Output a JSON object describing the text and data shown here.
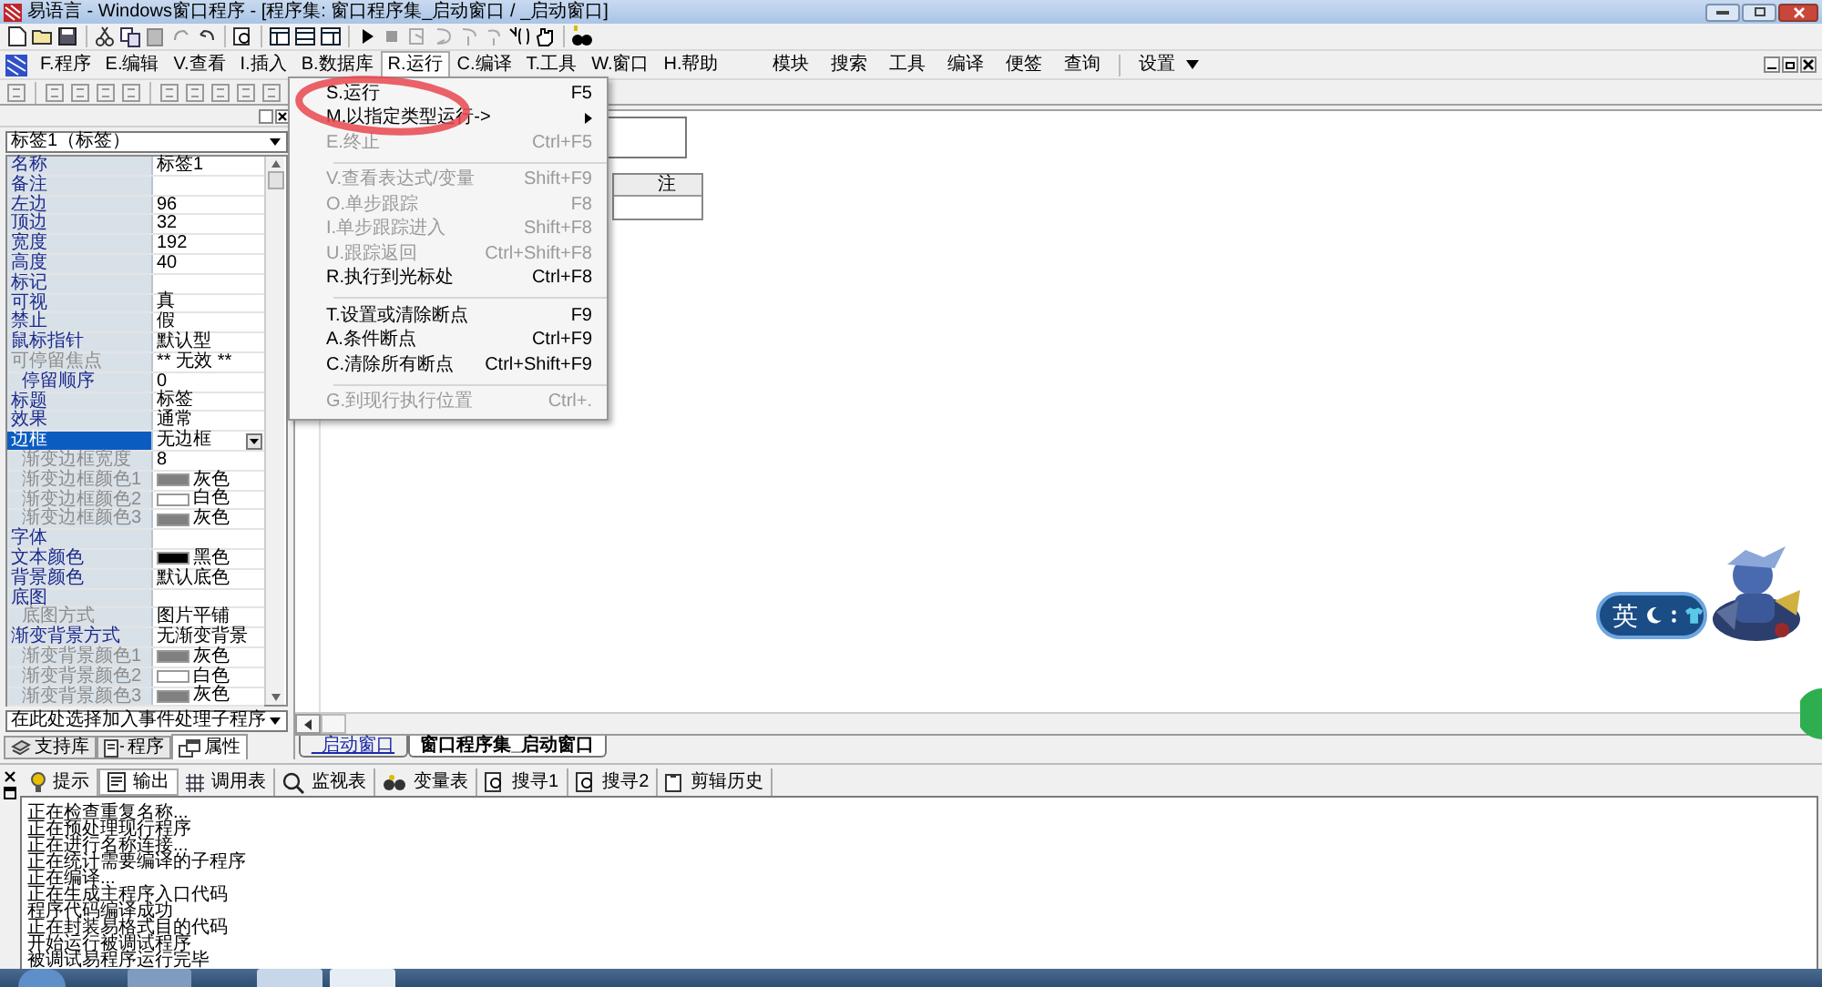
{
  "window": {
    "title": "易语言 - Windows窗口程序 - [程序集: 窗口程序集_启动窗口 / _启动窗口]"
  },
  "menu_bar": {
    "items": [
      {
        "label": "F.程序",
        "open": false
      },
      {
        "label": "E.编辑",
        "open": false
      },
      {
        "label": "V.查看",
        "open": false
      },
      {
        "label": "I.插入",
        "open": false
      },
      {
        "label": "B.数据库",
        "open": false
      },
      {
        "label": "R.运行",
        "open": true
      },
      {
        "label": "C.编译",
        "open": false
      },
      {
        "label": "T.工具",
        "open": false
      },
      {
        "label": "W.窗口",
        "open": false
      },
      {
        "label": "H.帮助",
        "open": false
      }
    ]
  },
  "quick_bar": {
    "items": [
      "模块",
      "搜索",
      "工具",
      "编译",
      "便签",
      "查询",
      "设置"
    ]
  },
  "run_menu": {
    "items": [
      {
        "kind": "item",
        "label": "S.运行",
        "shortcut": "F5",
        "disabled": false
      },
      {
        "kind": "submenu",
        "label": "M.以指定类型运行->",
        "disabled": false
      },
      {
        "kind": "item",
        "label": "E.终止",
        "shortcut": "Ctrl+F5",
        "disabled": true
      },
      {
        "kind": "separator"
      },
      {
        "kind": "item",
        "label": "V.查看表达式/变量",
        "shortcut": "Shift+F9",
        "disabled": true
      },
      {
        "kind": "item",
        "label": "O.单步跟踪",
        "shortcut": "F8",
        "disabled": true
      },
      {
        "kind": "item",
        "label": "I.单步跟踪进入",
        "shortcut": "Shift+F8",
        "disabled": true
      },
      {
        "kind": "item",
        "label": "U.跟踪返回",
        "shortcut": "Ctrl+Shift+F8",
        "disabled": true
      },
      {
        "kind": "item",
        "label": "R.执行到光标处",
        "shortcut": "Ctrl+F8",
        "disabled": false
      },
      {
        "kind": "separator"
      },
      {
        "kind": "item",
        "label": "T.设置或清除断点",
        "shortcut": "F9",
        "disabled": false
      },
      {
        "kind": "item",
        "label": "A.条件断点",
        "shortcut": "Ctrl+F9",
        "disabled": false
      },
      {
        "kind": "item",
        "label": "C.清除所有断点",
        "shortcut": "Ctrl+Shift+F9",
        "disabled": false
      },
      {
        "kind": "separator"
      },
      {
        "kind": "item",
        "label": "G.到现行执行位置",
        "shortcut": "Ctrl+.",
        "disabled": true
      }
    ]
  },
  "properties": {
    "object": "标签1（标签）",
    "rows": [
      {
        "name": "名称",
        "value": "标签1",
        "selected": false,
        "disabled": false
      },
      {
        "name": "备注",
        "selected": false,
        "disabled": false
      },
      {
        "name": "左边",
        "value": "96",
        "selected": false,
        "disabled": false
      },
      {
        "name": "顶边",
        "value": "32",
        "selected": false,
        "disabled": false
      },
      {
        "name": "宽度",
        "value": "192",
        "selected": false,
        "disabled": false
      },
      {
        "name": "高度",
        "value": "40",
        "selected": false,
        "disabled": false
      },
      {
        "name": "标记",
        "selected": false,
        "disabled": false
      },
      {
        "name": "可视",
        "value": "真",
        "selected": false,
        "disabled": false
      },
      {
        "name": "禁止",
        "value": "假",
        "selected": false,
        "disabled": false
      },
      {
        "name": "鼠标指针",
        "value": "默认型",
        "selected": false,
        "disabled": false
      },
      {
        "name": "可停留焦点",
        "value": "** 无效 **",
        "selected": false,
        "disabled": true,
        "children": [
          {
            "name": "停留顺序",
            "value": "0",
            "selected": false,
            "disabled": false
          }
        ]
      },
      {
        "name": "标题",
        "value": "标签",
        "selected": false,
        "disabled": false
      },
      {
        "name": "效果",
        "value": "通常",
        "selected": false,
        "disabled": false
      },
      {
        "name": "边框",
        "value": "无边框",
        "selected": true,
        "disabled": false,
        "children": [
          {
            "name": "渐变边框宽度",
            "value": "8",
            "selected": false,
            "disabled": true
          },
          {
            "name": "渐变边框颜色1",
            "value": "灰色",
            "color": "#808080",
            "selected": false,
            "disabled": true
          },
          {
            "name": "渐变边框颜色2",
            "value": "白色",
            "color": "#ffffff",
            "selected": false,
            "disabled": true
          },
          {
            "name": "渐变边框颜色3",
            "value": "灰色",
            "color": "#808080",
            "selected": false,
            "disabled": true
          }
        ]
      },
      {
        "name": "字体",
        "selected": false,
        "disabled": false
      },
      {
        "name": "文本颜色",
        "value": "黑色",
        "color": "#000000",
        "selected": false,
        "disabled": false
      },
      {
        "name": "背景颜色",
        "value": "默认底色",
        "selected": false,
        "disabled": false
      },
      {
        "name": "底图",
        "selected": false,
        "disabled": false,
        "children": [
          {
            "name": "底图方式",
            "value": "图片平铺",
            "selected": false,
            "disabled": true
          }
        ]
      },
      {
        "name": "渐变背景方式",
        "value": "无渐变背景",
        "selected": false,
        "disabled": false,
        "children": [
          {
            "name": "渐变背景颜色1",
            "value": "灰色",
            "color": "#808080",
            "selected": false,
            "disabled": true
          },
          {
            "name": "渐变背景颜色2",
            "value": "白色",
            "color": "#ffffff",
            "selected": false,
            "disabled": true
          },
          {
            "name": "渐变背景颜色3",
            "value": "灰色",
            "color": "#808080",
            "selected": false,
            "disabled": true
          }
        ]
      }
    ],
    "event_picker": "在此处选择加入事件处理子程序",
    "tabs": [
      {
        "label": "支持库",
        "selected": false
      },
      {
        "label": "程序",
        "selected": false
      },
      {
        "label": "属性",
        "selected": true
      }
    ]
  },
  "designer": {
    "table_header": "注"
  },
  "editor_tabs": [
    {
      "label": "_启动窗口",
      "selected": false
    },
    {
      "label": "窗口程序集_启动窗口",
      "selected": true
    }
  ],
  "output_panel": {
    "tabs": [
      {
        "label": "提示",
        "selected": false
      },
      {
        "label": "输出",
        "selected": true
      },
      {
        "label": "调用表",
        "selected": false
      },
      {
        "label": "监视表",
        "selected": false
      },
      {
        "label": "变量表",
        "selected": false
      },
      {
        "label": "搜寻1",
        "selected": false
      },
      {
        "label": "搜寻2",
        "selected": false
      },
      {
        "label": "剪辑历史",
        "selected": false
      }
    ],
    "lines": [
      "正在检查重复名称...",
      "正在预处理现行程序",
      "正在进行名称连接...",
      "正在统计需要编译的子程序",
      "正在编译...",
      "正在生成主程序入口代码",
      "程序代码编译成功",
      "正在封装易格式目的代码",
      "开始运行被调试程序",
      "被调试易程序运行完毕"
    ]
  },
  "ime_bar": {
    "label": "英"
  }
}
